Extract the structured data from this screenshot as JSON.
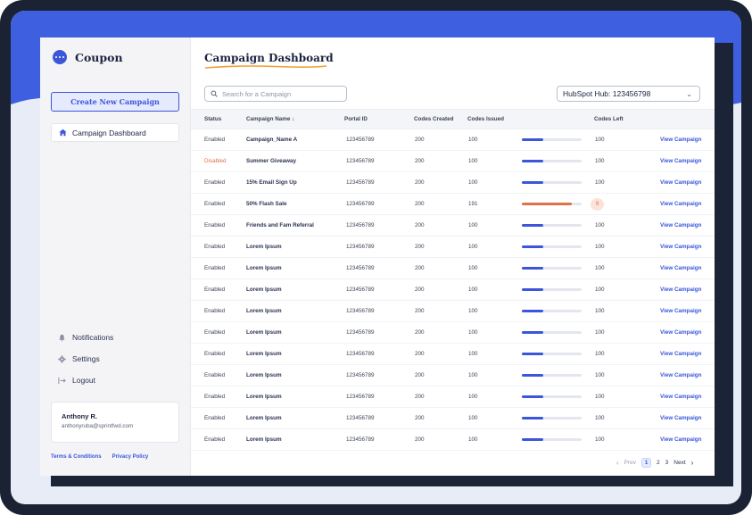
{
  "sidebar": {
    "brand": "Coupon",
    "create_label": "Create New Campaign",
    "nav_active": "Campaign Dashboard",
    "notifications": "Notifications",
    "settings": "Settings",
    "logout": "Logout",
    "user_name": "Anthony R.",
    "user_email": "anthonyruba@sprintfwd.com",
    "terms": "Terms & Conditions",
    "privacy": "Privacy Policy"
  },
  "main": {
    "title": "Campaign Dashboard",
    "search_placeholder": "Search for a Campaign",
    "hub_select": "HubSpot Hub: 123456798",
    "columns": [
      "Status",
      "Campaign Name",
      "Portal ID",
      "Codes Created",
      "Codes Issued",
      "Codes Left"
    ],
    "rows": [
      {
        "status": "Enabled",
        "name": "Campaign_Name A",
        "portal": "123456789",
        "created": "200",
        "issued": "100",
        "left": "100",
        "fill": 0.36,
        "link": "View Campaign"
      },
      {
        "status": "Disabled",
        "name": "Summer Giveaway",
        "portal": "123456789",
        "created": "200",
        "issued": "100",
        "left": "100",
        "fill": 0.36,
        "link": "View Campaign"
      },
      {
        "status": "Enabled",
        "name": "15% Email Sign Up",
        "portal": "123456789",
        "created": "200",
        "issued": "100",
        "left": "100",
        "fill": 0.36,
        "link": "View Campaign"
      },
      {
        "status": "Enabled",
        "name": "50% Flash Sale",
        "portal": "123456789",
        "created": "200",
        "issued": "191",
        "left": "9",
        "fill": 0.84,
        "link": "View Campaign",
        "alert": true
      },
      {
        "status": "Enabled",
        "name": "Friends and Fam Referral",
        "portal": "123456789",
        "created": "200",
        "issued": "100",
        "left": "100",
        "fill": 0.36,
        "link": "View Campaign"
      },
      {
        "status": "Enabled",
        "name": "Lorem Ipsum",
        "portal": "123456789",
        "created": "200",
        "issued": "100",
        "left": "100",
        "fill": 0.36,
        "link": "View Campaign"
      },
      {
        "status": "Enabled",
        "name": "Lorem Ipsum",
        "portal": "123456789",
        "created": "200",
        "issued": "100",
        "left": "100",
        "fill": 0.36,
        "link": "View Campaign"
      },
      {
        "status": "Enabled",
        "name": "Lorem Ipsum",
        "portal": "123456789",
        "created": "200",
        "issued": "100",
        "left": "100",
        "fill": 0.36,
        "link": "View Campaign"
      },
      {
        "status": "Enabled",
        "name": "Lorem Ipsum",
        "portal": "123456789",
        "created": "200",
        "issued": "100",
        "left": "100",
        "fill": 0.36,
        "link": "View Campaign"
      },
      {
        "status": "Enabled",
        "name": "Lorem Ipsum",
        "portal": "123456789",
        "created": "200",
        "issued": "100",
        "left": "100",
        "fill": 0.36,
        "link": "View Campaign"
      },
      {
        "status": "Enabled",
        "name": "Lorem Ipsum",
        "portal": "123456789",
        "created": "200",
        "issued": "100",
        "left": "100",
        "fill": 0.36,
        "link": "View Campaign"
      },
      {
        "status": "Enabled",
        "name": "Lorem Ipsum",
        "portal": "123456789",
        "created": "200",
        "issued": "100",
        "left": "100",
        "fill": 0.36,
        "link": "View Campaign"
      },
      {
        "status": "Enabled",
        "name": "Lorem Ipsum",
        "portal": "123456789",
        "created": "200",
        "issued": "100",
        "left": "100",
        "fill": 0.36,
        "link": "View Campaign"
      },
      {
        "status": "Enabled",
        "name": "Lorem Ipsum",
        "portal": "123456789",
        "created": "200",
        "issued": "100",
        "left": "100",
        "fill": 0.36,
        "link": "View Campaign"
      },
      {
        "status": "Enabled",
        "name": "Lorem Ipsum",
        "portal": "123456789",
        "created": "200",
        "issued": "100",
        "left": "100",
        "fill": 0.36,
        "link": "View Campaign"
      }
    ],
    "pagination": {
      "prev": "Prev",
      "pages": [
        "1",
        "2",
        "3"
      ],
      "current": "1",
      "next": "Next"
    }
  },
  "colors": {
    "accent": "#3b56d9",
    "warning": "#e07045",
    "background_band": "#3e5fe0",
    "bar_normal": "#3b56d9",
    "bar_alert": "#e07045"
  },
  "icons": [
    "brand-logo-icon",
    "home-icon",
    "bell-icon",
    "gear-icon",
    "logout-icon",
    "search-icon",
    "chevron-down-icon",
    "sort-down-icon"
  ]
}
